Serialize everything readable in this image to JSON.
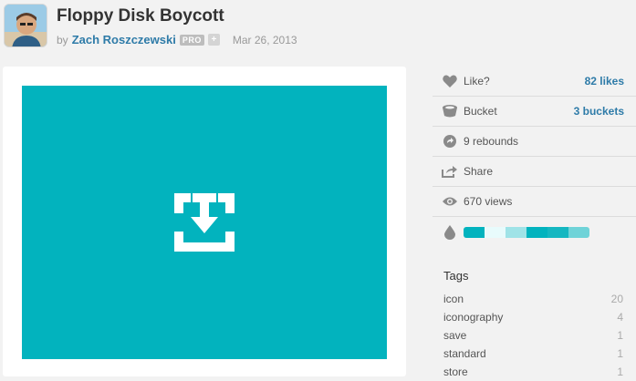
{
  "shot": {
    "title": "Floppy Disk Boycott",
    "by": "by",
    "author": "Zach Roszczewski",
    "badge": "PRO",
    "plus": "+",
    "date": "Mar 26, 2013",
    "canvas_color": "#02b3be"
  },
  "stats": [
    {
      "icon": "heart-icon",
      "label": "Like?",
      "value": "82 likes"
    },
    {
      "icon": "bucket-icon",
      "label": "Bucket",
      "value": "3 buckets"
    },
    {
      "icon": "rebound-icon",
      "label": "9 rebounds",
      "value": ""
    },
    {
      "icon": "share-icon",
      "label": "Share",
      "value": ""
    },
    {
      "icon": "eye-icon",
      "label": "670 views",
      "value": ""
    }
  ],
  "palette": [
    "#02b3be",
    "#e8fbfc",
    "#9fe3e7",
    "#02b3be",
    "#15b7c1",
    "#6fd3d8"
  ],
  "tags_heading": "Tags",
  "tags": [
    {
      "name": "icon",
      "count": "20"
    },
    {
      "name": "iconography",
      "count": "4"
    },
    {
      "name": "save",
      "count": "1"
    },
    {
      "name": "standard",
      "count": "1"
    },
    {
      "name": "store",
      "count": "1"
    }
  ]
}
